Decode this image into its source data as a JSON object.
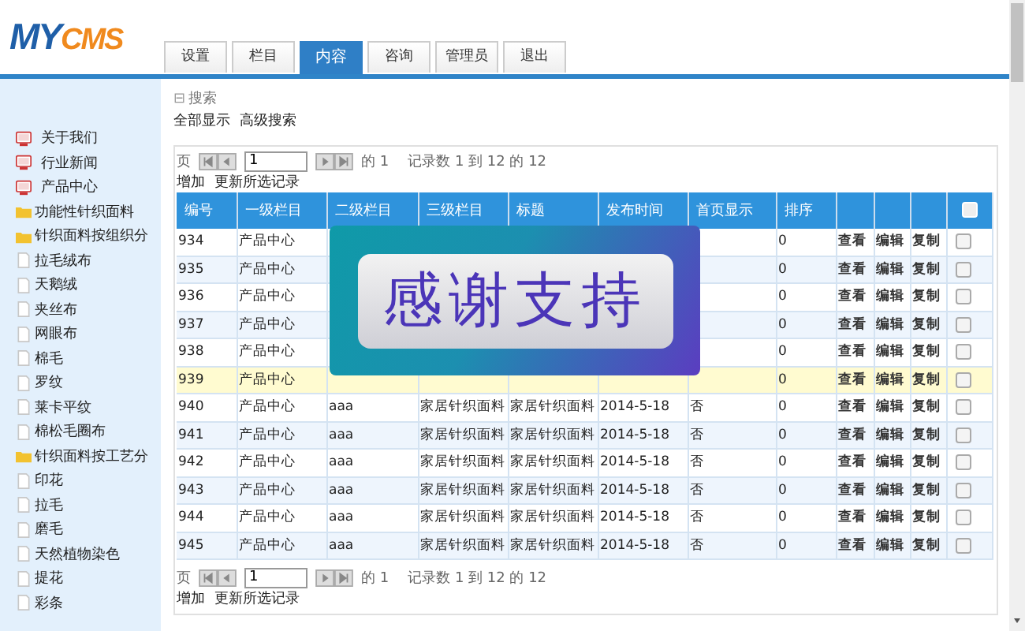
{
  "logo": {
    "first": "MY",
    "second": "CMS"
  },
  "tabs": [
    {
      "label": "设置",
      "selected": false
    },
    {
      "label": "栏目",
      "selected": false
    },
    {
      "label": "内容",
      "selected": true
    },
    {
      "label": "咨询",
      "selected": false
    },
    {
      "label": "管理员",
      "selected": false
    },
    {
      "label": "退出",
      "selected": false
    }
  ],
  "sidebar": {
    "items": [
      {
        "label": "关于我们",
        "kind": "page"
      },
      {
        "label": "行业新闻",
        "kind": "page"
      },
      {
        "label": "产品中心",
        "kind": "page"
      },
      {
        "label": "功能性针织面料",
        "kind": "folder"
      },
      {
        "label": "针织面料按组织分",
        "kind": "folder"
      },
      {
        "label": "拉毛绒布",
        "kind": "file"
      },
      {
        "label": "天鹅绒",
        "kind": "file"
      },
      {
        "label": "夹丝布",
        "kind": "file"
      },
      {
        "label": "网眼布",
        "kind": "file"
      },
      {
        "label": "棉毛",
        "kind": "file"
      },
      {
        "label": "罗纹",
        "kind": "file"
      },
      {
        "label": "莱卡平纹",
        "kind": "file"
      },
      {
        "label": "棉松毛圈布",
        "kind": "file"
      },
      {
        "label": "针织面料按工艺分",
        "kind": "folder"
      },
      {
        "label": "印花",
        "kind": "file"
      },
      {
        "label": "拉毛",
        "kind": "file"
      },
      {
        "label": "磨毛",
        "kind": "file"
      },
      {
        "label": "天然植物染色",
        "kind": "file"
      },
      {
        "label": "提花",
        "kind": "file"
      },
      {
        "label": "彩条",
        "kind": "file"
      }
    ]
  },
  "search": {
    "toggle": "⊟",
    "label": "搜索",
    "links": [
      "全部显示",
      "高级搜索"
    ]
  },
  "pager_top": {
    "page_label": "页",
    "page": "1",
    "of": "的 1",
    "records": "记录数 1 到 12 的 12"
  },
  "actions_top": [
    "增加",
    "更新所选记录"
  ],
  "table": {
    "columns": [
      "编号",
      "一级栏目",
      "二级栏目",
      "三级栏目",
      "标题",
      "发布时间",
      "首页显示",
      "排序"
    ],
    "select_all_checked": false,
    "rows": [
      {
        "cells": [
          "934",
          "产品中心",
          null,
          null,
          null,
          null,
          null,
          "0"
        ],
        "actions": [
          "查看",
          "编辑",
          "复制"
        ],
        "highlighted": false,
        "checked": false
      },
      {
        "cells": [
          "935",
          "产品中心",
          null,
          null,
          null,
          null,
          null,
          "0"
        ],
        "actions": [
          "查看",
          "编辑",
          "复制"
        ],
        "highlighted": false,
        "checked": false
      },
      {
        "cells": [
          "936",
          "产品中心",
          null,
          null,
          null,
          null,
          null,
          "0"
        ],
        "actions": [
          "查看",
          "编辑",
          "复制"
        ],
        "highlighted": false,
        "checked": false
      },
      {
        "cells": [
          "937",
          "产品中心",
          null,
          null,
          null,
          null,
          null,
          "0"
        ],
        "actions": [
          "查看",
          "编辑",
          "复制"
        ],
        "highlighted": false,
        "checked": false
      },
      {
        "cells": [
          "938",
          "产品中心",
          null,
          null,
          null,
          null,
          null,
          "0"
        ],
        "actions": [
          "查看",
          "编辑",
          "复制"
        ],
        "highlighted": false,
        "checked": false
      },
      {
        "cells": [
          "939",
          "产品中心",
          null,
          null,
          null,
          null,
          null,
          "0"
        ],
        "actions": [
          "查看",
          "编辑",
          "复制"
        ],
        "highlighted": true,
        "checked": false
      },
      {
        "cells": [
          "940",
          "产品中心",
          "aaa",
          "家居针织面料",
          "家居针织面料",
          "2014-5-18",
          "否",
          "0"
        ],
        "actions": [
          "查看",
          "编辑",
          "复制"
        ],
        "highlighted": false,
        "checked": false
      },
      {
        "cells": [
          "941",
          "产品中心",
          "aaa",
          "家居针织面料",
          "家居针织面料",
          "2014-5-18",
          "否",
          "0"
        ],
        "actions": [
          "查看",
          "编辑",
          "复制"
        ],
        "highlighted": false,
        "checked": false
      },
      {
        "cells": [
          "942",
          "产品中心",
          "aaa",
          "家居针织面料",
          "家居针织面料",
          "2014-5-18",
          "否",
          "0"
        ],
        "actions": [
          "查看",
          "编辑",
          "复制"
        ],
        "highlighted": false,
        "checked": false
      },
      {
        "cells": [
          "943",
          "产品中心",
          "aaa",
          "家居针织面料",
          "家居针织面料",
          "2014-5-18",
          "否",
          "0"
        ],
        "actions": [
          "查看",
          "编辑",
          "复制"
        ],
        "highlighted": false,
        "checked": false
      },
      {
        "cells": [
          "944",
          "产品中心",
          "aaa",
          "家居针织面料",
          "家居针织面料",
          "2014-5-18",
          "否",
          "0"
        ],
        "actions": [
          "查看",
          "编辑",
          "复制"
        ],
        "highlighted": false,
        "checked": false
      },
      {
        "cells": [
          "945",
          "产品中心",
          "aaa",
          "家居针织面料",
          "家居针织面料",
          "2014-5-18",
          "否",
          "0"
        ],
        "actions": [
          "查看",
          "编辑",
          "复制"
        ],
        "highlighted": false,
        "checked": false
      }
    ]
  },
  "pager_bottom": {
    "page_label": "页",
    "page": "1",
    "of": "的 1",
    "records": "记录数 1 到 12 的 12"
  },
  "actions_bottom": [
    "增加",
    "更新所选记录"
  ],
  "banner": {
    "text": "感谢支持"
  }
}
